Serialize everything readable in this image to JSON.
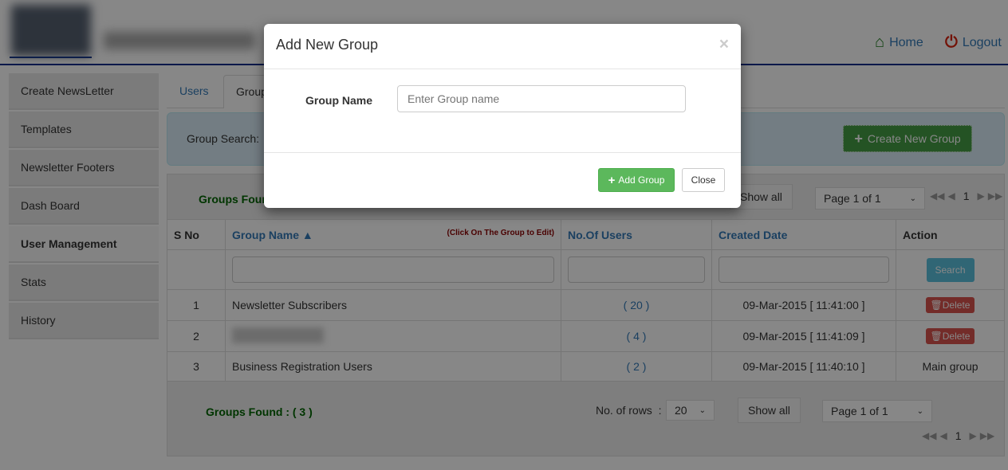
{
  "header": {
    "home": "Home",
    "logout": "Logout",
    "colors": {
      "home_icon": "#1a7a1a",
      "logout_icon": "#d9230f"
    }
  },
  "sidebar": {
    "items": [
      {
        "label": "Create NewsLetter"
      },
      {
        "label": "Templates"
      },
      {
        "label": "Newsletter Footers"
      },
      {
        "label": "Dash Board"
      },
      {
        "label": "User Management",
        "active": true
      },
      {
        "label": "Stats"
      },
      {
        "label": "History"
      }
    ]
  },
  "tabs": [
    {
      "label": "Users"
    },
    {
      "label": "Groups",
      "active": true
    }
  ],
  "search_panel": {
    "label": "Group Search:",
    "create_button": "Create New Group"
  },
  "top_bar": {
    "groups_found": "Groups Found : ( 3 )",
    "show_all": "Show all",
    "page_select": "Page 1 of 1",
    "page_number": "1"
  },
  "table": {
    "headers": {
      "sno": "S No",
      "group_name": "Group Name ▲",
      "hint": "(Click On The Group to Edit)",
      "users": "No.Of Users",
      "created": "Created Date",
      "action": "Action"
    },
    "search_button": "Search",
    "rows": [
      {
        "sno": "1",
        "name": "Newsletter Subscribers",
        "users": "( 20 )",
        "created": "09-Mar-2015 [ 11:41:00 ]",
        "action": "Delete"
      },
      {
        "sno": "2",
        "name": "",
        "users": "( 4 )",
        "created": "09-Mar-2015 [ 11:41:09 ]",
        "action": "Delete"
      },
      {
        "sno": "3",
        "name": "Business Registration Users",
        "users": "( 2 )",
        "created": "09-Mar-2015 [ 11:40:10 ]",
        "action": "Main group"
      }
    ]
  },
  "bottom_bar": {
    "groups_found": "Groups Found : ( 3 )",
    "rows_label": "No. of rows  :",
    "rows_value": "20",
    "show_all": "Show all",
    "page_select": "Page 1 of 1",
    "page_number": "1"
  },
  "modal": {
    "title": "Add New Group",
    "close_x": "×",
    "field_label": "Group Name",
    "placeholder": "Enter Group name",
    "add_button": "Add Group",
    "close_button": "Close"
  }
}
